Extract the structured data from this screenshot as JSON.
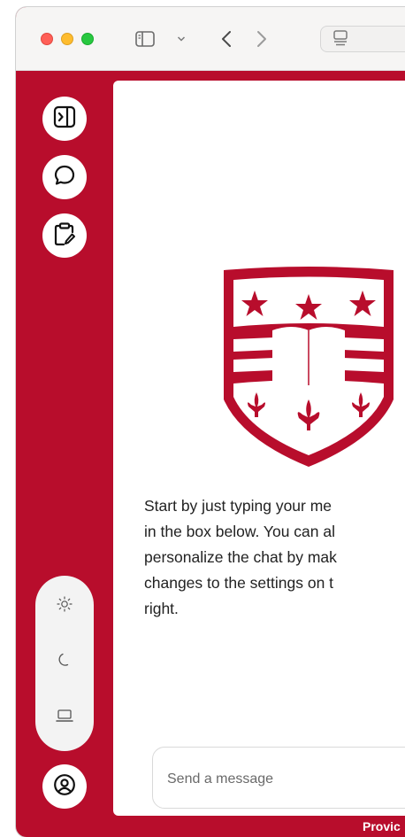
{
  "browser": {
    "toolbar_icons": [
      "sidebar-toggle-icon",
      "chevron-down-icon",
      "back-arrow-icon",
      "forward-arrow-icon",
      "tab-overview-icon"
    ]
  },
  "sidebar": {
    "icons": [
      "collapse-sidebar-icon",
      "chat-icon",
      "clipboard-edit-icon",
      "user-profile-icon"
    ],
    "theme_options": [
      "light-theme-icon",
      "dark-theme-icon",
      "system-theme-icon"
    ]
  },
  "main": {
    "logo": "shield-crest-logo",
    "intro_text": "Start by just typing your me\nin the box below. You can al\npersonalize the chat by mak\nchanges to the settings on t\nright.",
    "composer": {
      "placeholder": "Send a message"
    }
  },
  "footer": {
    "text": "Provic"
  },
  "colors": {
    "brand_red": "#b80d2c",
    "background": "#ffffff"
  }
}
